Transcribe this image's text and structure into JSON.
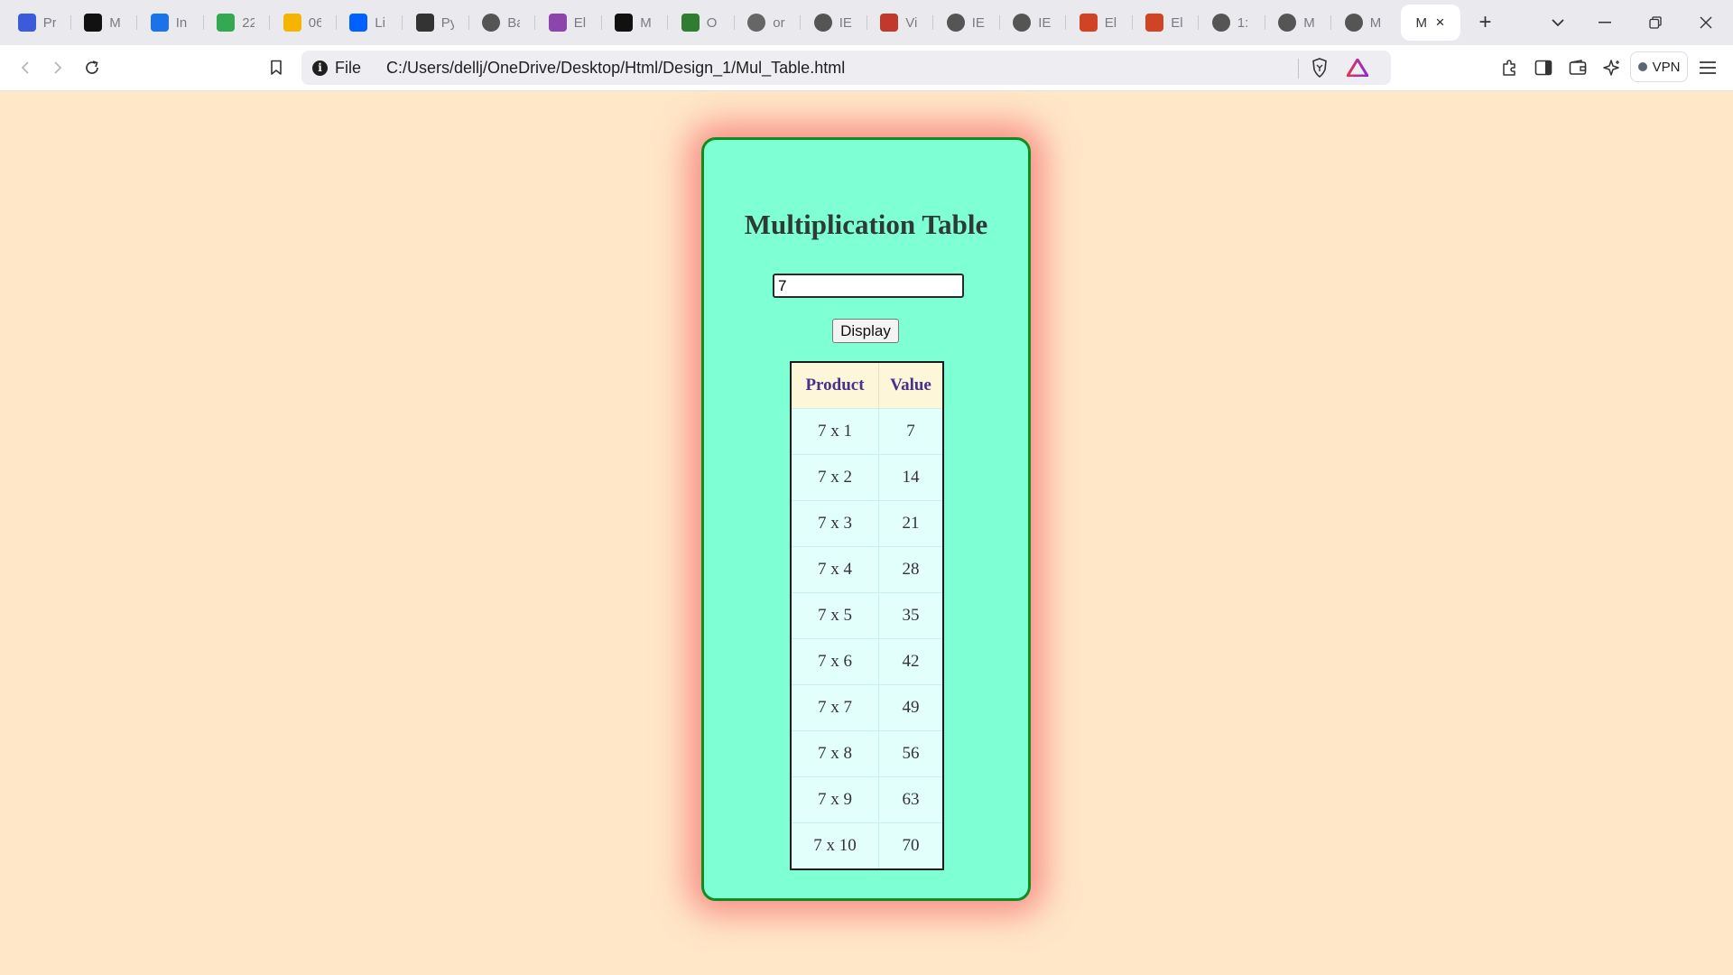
{
  "browser": {
    "tabs": [
      {
        "icon": "power-icon",
        "label": "Pr",
        "color": "#3b5bdb"
      },
      {
        "icon": "x-logo-icon",
        "label": "M",
        "color": "#111111"
      },
      {
        "icon": "face-icon",
        "label": "In",
        "color": "#1a73e8"
      },
      {
        "icon": "drive-icon",
        "label": "22",
        "color": "#34a853"
      },
      {
        "icon": "slides-icon",
        "label": "06",
        "color": "#f4b400"
      },
      {
        "icon": "dropbox-icon",
        "label": "Li",
        "color": "#0061fe"
      },
      {
        "icon": "book-icon",
        "label": "Py",
        "color": "#333333"
      },
      {
        "icon": "globe-icon",
        "label": "Ba",
        "color": "#555555"
      },
      {
        "icon": "layers-icon",
        "label": "El",
        "color": "#8e44ad"
      },
      {
        "icon": "medium-icon",
        "label": "M",
        "color": "#111111"
      },
      {
        "icon": "leaf-icon",
        "label": "O",
        "color": "#2e7d32"
      },
      {
        "icon": "globe-icon",
        "label": "or",
        "color": "#666666"
      },
      {
        "icon": "globe-icon",
        "label": "IE",
        "color": "#555555"
      },
      {
        "icon": "target-icon",
        "label": "Vi",
        "color": "#c0392b"
      },
      {
        "icon": "globe-icon",
        "label": "IE",
        "color": "#555555"
      },
      {
        "icon": "globe-icon",
        "label": "IE",
        "color": "#555555"
      },
      {
        "icon": "powerpoint-icon",
        "label": "El",
        "color": "#d04423"
      },
      {
        "icon": "powerpoint-icon",
        "label": "El",
        "color": "#d04423"
      },
      {
        "icon": "globe-icon",
        "label": "1:",
        "color": "#555555"
      },
      {
        "icon": "globe-icon",
        "label": "M",
        "color": "#555555"
      },
      {
        "icon": "globe-icon",
        "label": "M",
        "color": "#555555"
      }
    ],
    "active_tab": {
      "label": "M",
      "close": "×"
    },
    "new_tab": "+",
    "window_controls": {
      "minimize": "—",
      "restore": "❐",
      "close": "✕"
    },
    "address": {
      "scheme_label": "File",
      "url": "C:/Users/dellj/OneDrive/Desktop/Html/Design_1/Mul_Table.html"
    },
    "vpn_label": "VPN"
  },
  "page": {
    "title": "Multiplication Table",
    "input_value": "7",
    "button_label": "Display",
    "table": {
      "headers": [
        "Product",
        "Value"
      ],
      "rows": [
        [
          "7 x 1",
          "7"
        ],
        [
          "7 x 2",
          "14"
        ],
        [
          "7 x 3",
          "21"
        ],
        [
          "7 x 4",
          "28"
        ],
        [
          "7 x 5",
          "35"
        ],
        [
          "7 x 6",
          "42"
        ],
        [
          "7 x 7",
          "49"
        ],
        [
          "7 x 8",
          "56"
        ],
        [
          "7 x 9",
          "63"
        ],
        [
          "7 x 10",
          "70"
        ]
      ]
    }
  },
  "colors": {
    "page_background": "#ffe7c8",
    "card_background": "#7fffd4",
    "card_border": "#128b20",
    "card_glow": "#f56e6e",
    "header_text": "#4b2e8f"
  }
}
